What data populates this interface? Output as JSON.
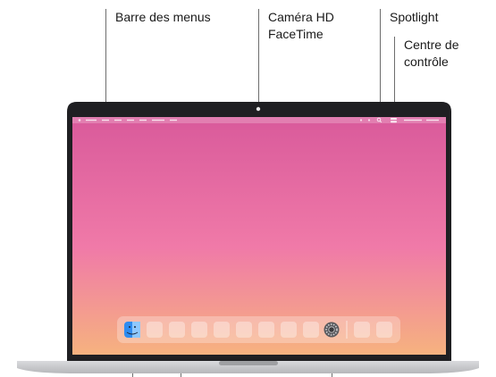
{
  "callouts": {
    "menu_bar": "Barre des menus",
    "camera_line1": "Caméra HD",
    "camera_line2": "FaceTime",
    "spotlight": "Spotlight",
    "control_line1": "Centre de",
    "control_line2": "contrôle"
  },
  "icons": {
    "finder": "finder-icon",
    "settings": "system-settings-icon",
    "search": "spotlight-search-icon",
    "control_center": "control-center-icon"
  },
  "colors": {
    "wallpaper_top": "#d95a9b",
    "wallpaper_mid": "#f07aa8",
    "wallpaper_bottom": "#f6b27f",
    "bezel": "#1f1f22",
    "body": "#c9cacd"
  },
  "dock": {
    "app_slots": 9,
    "extra_slots": 2
  }
}
